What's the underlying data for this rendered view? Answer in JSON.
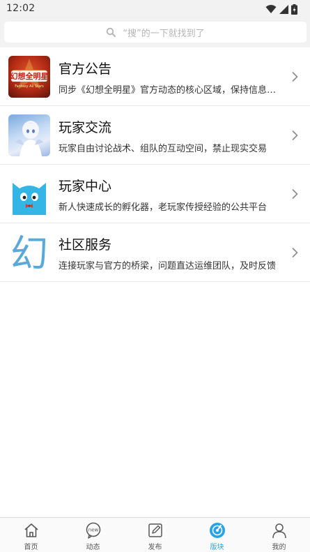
{
  "status_bar": {
    "time": "12:02"
  },
  "search": {
    "placeholder": "“搜”的一下就找到了"
  },
  "forums": [
    {
      "title": "官方公告",
      "desc": "同步《幻想全明星》官方动态的核心区域，保持信息第一时间同步",
      "thumb_icon": "game-logo-thumbnail",
      "logo_text": "幻想全明星",
      "logo_sub": "Fantasy All Stars"
    },
    {
      "title": "玩家交流",
      "desc": "玩家自由讨论战术、组队的互动空间，禁止现实交易",
      "thumb_icon": "anime-character-thumbnail"
    },
    {
      "title": "玩家中心",
      "desc": "新人快速成长的孵化器，老玩家传授经验的公共平台",
      "thumb_icon": "blue-cat-mascot-thumbnail"
    },
    {
      "title": "社区服务",
      "desc": "连接玩家与官方的桥梁，问题直达运维团队，及时反馈",
      "thumb_icon": "calligraphy-character-thumbnail",
      "glyph": "幻"
    }
  ],
  "tabbar": {
    "active": "版块",
    "tabs": [
      {
        "label": "首页",
        "icon": "home-icon"
      },
      {
        "label": "动态",
        "icon": "new-badge-icon",
        "badge": "new"
      },
      {
        "label": "发布",
        "icon": "edit-icon"
      },
      {
        "label": "版块",
        "icon": "compass-icon"
      },
      {
        "label": "我的",
        "icon": "user-icon"
      }
    ]
  },
  "colors": {
    "accent": "#29a3e8",
    "background": "#f2f2f2"
  }
}
